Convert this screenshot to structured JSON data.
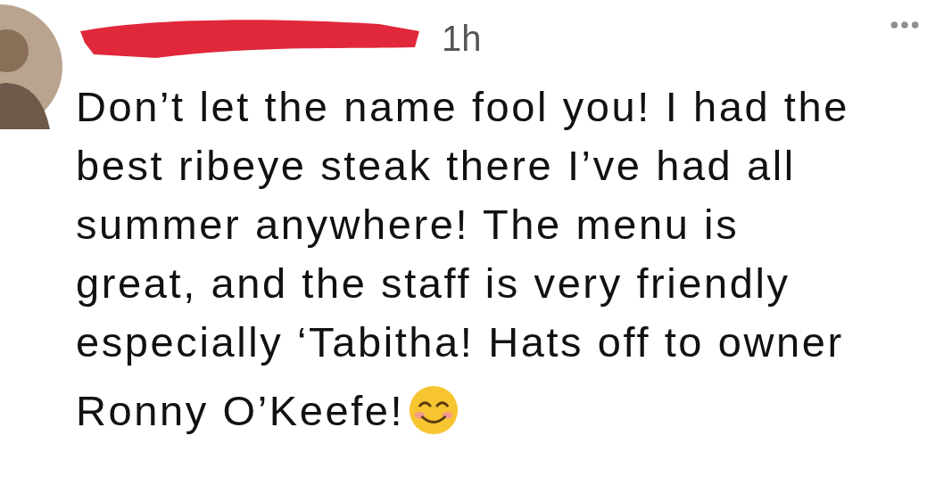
{
  "comment": {
    "time": "1h",
    "lines": [
      "Don’t let the name fool you! I had the",
      "best ribeye steak there I’ve had all",
      "summer anywhere! The menu is",
      "great, and the staff is very friendly",
      "especially ‘Tabitha! Hats off to owner",
      "Ronny O’Keefe!"
    ]
  }
}
